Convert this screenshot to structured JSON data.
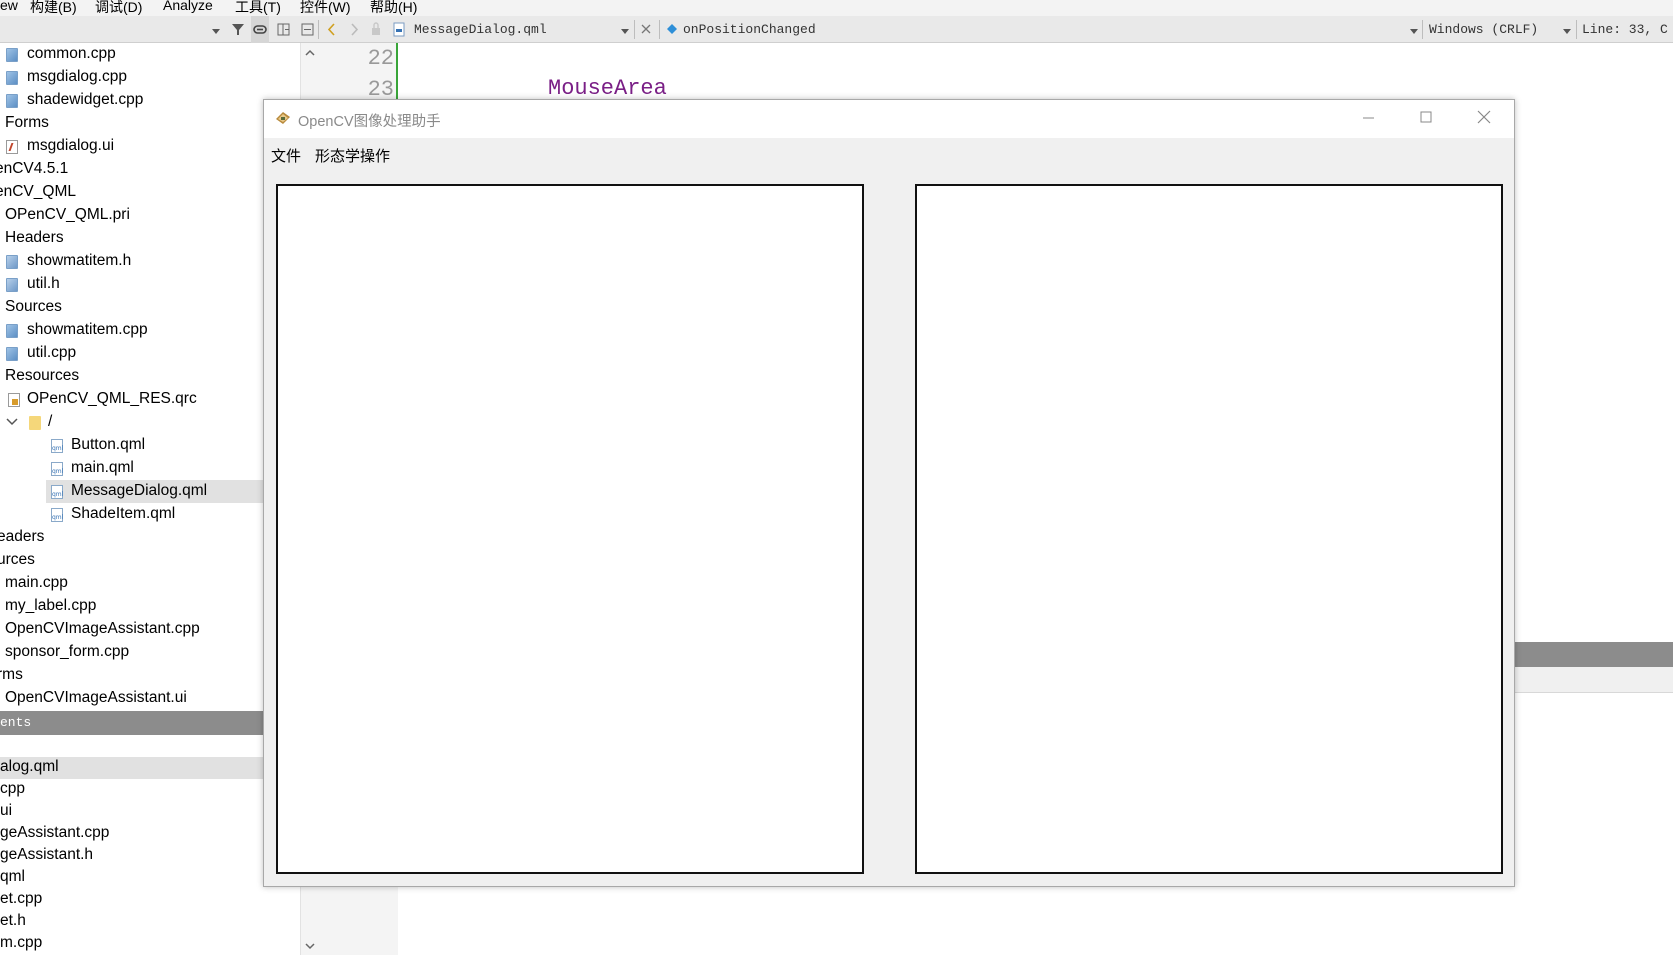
{
  "menubar": {
    "items": [
      "ew",
      "构建(B)",
      "调试(D)",
      "Analyze",
      "工具(T)",
      "控件(W)",
      "帮助(H)"
    ]
  },
  "toolbar": {
    "file_name": "MessageDialog.qml",
    "symbol": "onPositionChanged",
    "line_ending": "Windows (CRLF)",
    "position": "Line: 33, C"
  },
  "tree": {
    "items": [
      {
        "label": "common.cpp",
        "icon": "cpp-file-icon"
      },
      {
        "label": "msgdialog.cpp",
        "icon": "cpp-file-icon"
      },
      {
        "label": "shadewidget.cpp",
        "icon": "cpp-file-icon"
      },
      {
        "label": "Forms",
        "icon": ""
      },
      {
        "label": "msgdialog.ui",
        "icon": "ui-file-icon"
      },
      {
        "label": "enCV4.5.1",
        "icon": ""
      },
      {
        "label": "enCV_QML",
        "icon": ""
      },
      {
        "label": "OPenCV_QML.pri",
        "icon": ""
      },
      {
        "label": "Headers",
        "icon": ""
      },
      {
        "label": "showmatitem.h",
        "icon": "header-file-icon"
      },
      {
        "label": "util.h",
        "icon": "header-file-icon"
      },
      {
        "label": "Sources",
        "icon": ""
      },
      {
        "label": "showmatitem.cpp",
        "icon": "cpp-file-icon"
      },
      {
        "label": "util.cpp",
        "icon": "cpp-file-icon"
      },
      {
        "label": "Resources",
        "icon": ""
      },
      {
        "label": "OPenCV_QML_RES.qrc",
        "icon": "qrc-file-icon"
      },
      {
        "label": "/",
        "icon": "folder-icon"
      },
      {
        "label": "Button.qml",
        "icon": "qml-file-icon"
      },
      {
        "label": "main.qml",
        "icon": "qml-file-icon"
      },
      {
        "label": "MessageDialog.qml",
        "icon": "qml-file-icon"
      },
      {
        "label": "ShadeItem.qml",
        "icon": "qml-file-icon"
      },
      {
        "label": "eaders",
        "icon": ""
      },
      {
        "label": "urces",
        "icon": ""
      },
      {
        "label": "main.cpp",
        "icon": ""
      },
      {
        "label": "my_label.cpp",
        "icon": ""
      },
      {
        "label": "OpenCVImageAssistant.cpp",
        "icon": ""
      },
      {
        "label": "sponsor_form.cpp",
        "icon": ""
      },
      {
        "label": "rms",
        "icon": ""
      },
      {
        "label": "OpenCVImageAssistant.ui",
        "icon": ""
      }
    ],
    "selected": "MessageDialog.qml"
  },
  "open_documents": {
    "header": "ents",
    "items": [
      "alog.qml",
      "cpp",
      "ui",
      "geAssistant.cpp",
      "geAssistant.h",
      "qml",
      "et.cpp",
      "et.h",
      "m.cpp"
    ]
  },
  "editor": {
    "line_numbers": [
      "22",
      "23"
    ],
    "code": "MouseArea"
  },
  "dialog": {
    "title": "OpenCV图像处理助手",
    "menu": [
      "文件",
      "形态学操作"
    ]
  }
}
